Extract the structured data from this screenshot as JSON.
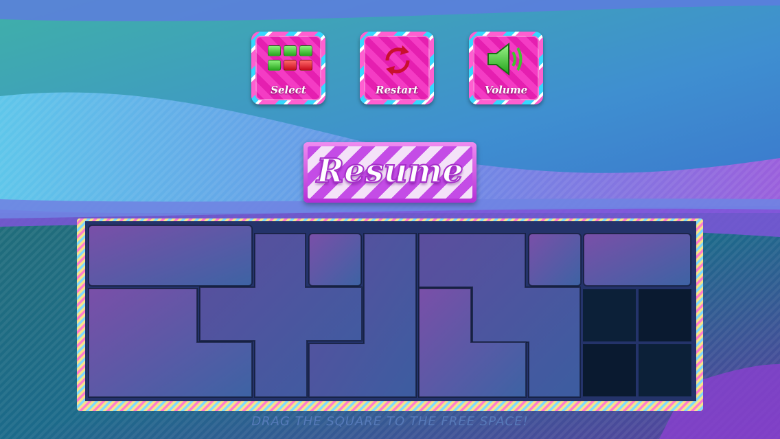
{
  "menu": {
    "select_label": "Select",
    "restart_label": "Restart",
    "volume_label": "Volume",
    "resume_label": "Resume"
  },
  "hint": "DRAG THE SQUARE TO THE FREE SPACE!",
  "icons": {
    "select": "grid-icon",
    "restart": "restart-arrows-icon",
    "volume": "speaker-icon"
  },
  "colors": {
    "button_pink": "#e51fb0",
    "resume_purple": "#c44ce6",
    "block_purple": "#6a4fa0",
    "free_space": "#0b1d36"
  }
}
